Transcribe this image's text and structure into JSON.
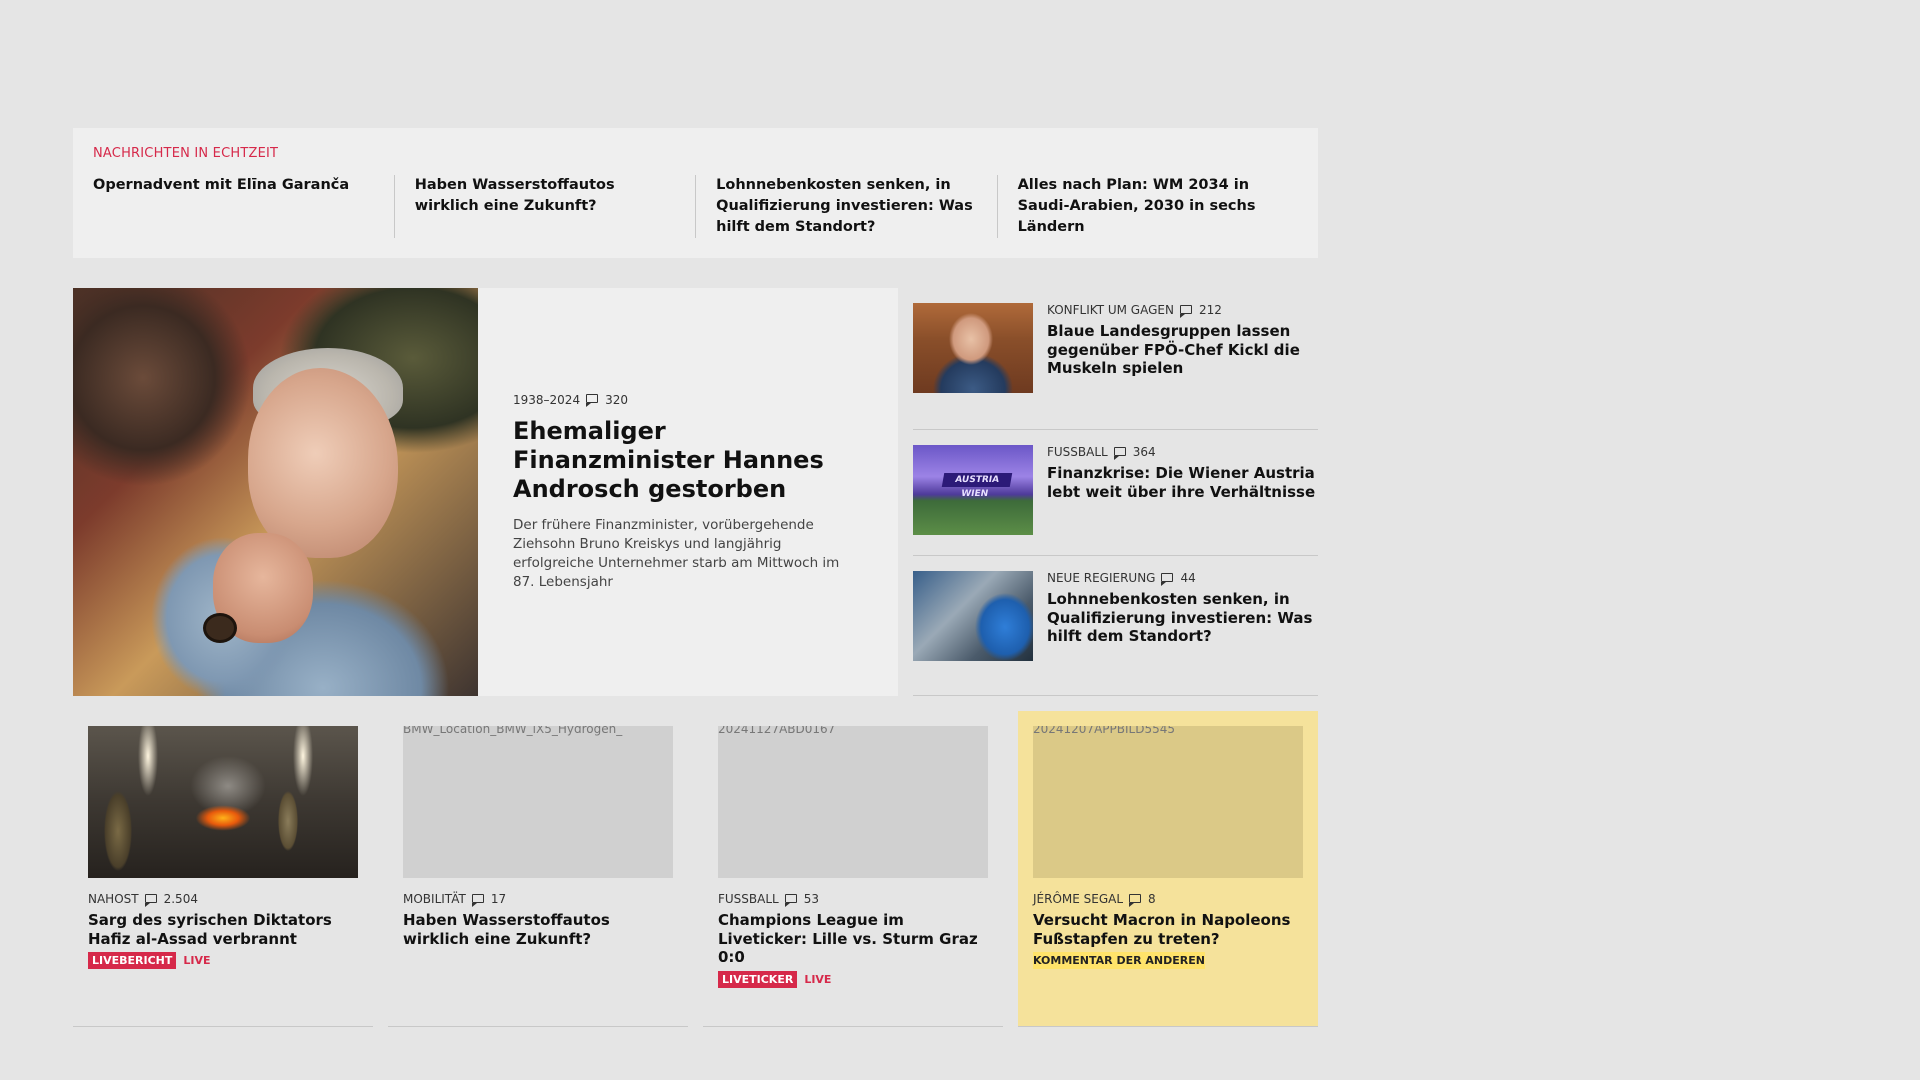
{
  "ticker": {
    "heading": "NACHRICHTEN IN ECHTZEIT",
    "items": [
      "Opernadvent mit Elīna Garanča",
      "Haben Wasserstoffautos wirklich eine Zukunft?",
      "Lohnnebenkosten senken, in Qualifizierung investieren: Was hilft dem Standort?",
      "Alles nach Plan: WM 2034 in Saudi-Arabien, 2030 in sechs Ländern"
    ]
  },
  "lead": {
    "kicker": "1938–2024",
    "comments": "320",
    "title": "Ehemaliger Finanzminister Hannes Androsch gestorben",
    "teaser": "Der frühere Finanzminister, vorübergehende Ziehsohn Bruno Kreiskys und langjährig erfolgreiche Unternehmer starb am Mittwoch im 87. Lebensjahr"
  },
  "side": [
    {
      "kicker": "KONFLIKT UM GAGEN",
      "comments": "212",
      "title": "Blaue Landesgruppen lassen gegenüber FPÖ-Chef Kickl die Muskeln spielen"
    },
    {
      "kicker": "FUSSBALL",
      "comments": "364",
      "title": "Finanzkrise: Die Wiener Austria lebt weit über ihre Verhältnisse",
      "image_banner": "AUSTRIA WIEN"
    },
    {
      "kicker": "NEUE REGIERUNG",
      "comments": "44",
      "title": "Lohnnebenkosten senken, in Qualifizierung investieren: Was hilft dem Standort?"
    }
  ],
  "cards": [
    {
      "kicker": "NAHOST",
      "comments": "2.504",
      "title": "Sarg des syrischen Diktators Hafiz al-Assad verbrannt",
      "badge": "LIVEBERICHT",
      "live": "LIVE"
    },
    {
      "kicker": "MOBILITÄT",
      "comments": "17",
      "title": "Haben Wasserstoffautos wirklich eine Zukunft?",
      "image_alt": "BMW_Location_BMW_iX5_Hydrogen_"
    },
    {
      "kicker": "FUSSBALL",
      "comments": "53",
      "title": "Champions League im Liveticker: Lille vs. Sturm Graz 0:0",
      "image_alt": "20241127ABD0167",
      "badge": "LIVETICKER",
      "live": "LIVE"
    },
    {
      "kicker": "JÉRÔME SEGAL",
      "comments": "8",
      "title": "Versucht Macron in Napoleons Fußstapfen zu treten?",
      "image_alt": "20241207APPBILD5545",
      "label": "KOMMENTAR DER ANDEREN"
    }
  ],
  "colors": {
    "accent_red": "#d6294a",
    "opinion_yellow": "#f5e29b",
    "page_background": "#e5e5e5"
  }
}
